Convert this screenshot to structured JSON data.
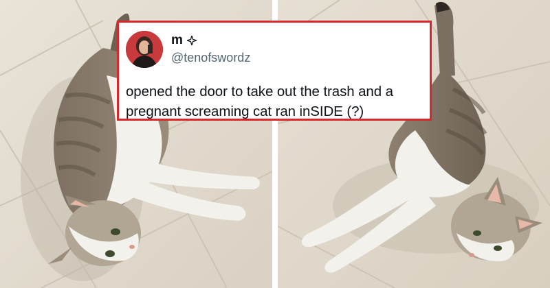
{
  "post": {
    "display_name": "m",
    "name_badge_icon": "sparkle-icon",
    "handle": "@tenofswordz",
    "text": "opened the door to take out the trash and a pregnant screaming cat ran inSIDE (?)",
    "frame_color": "#d9262b"
  },
  "photos": [
    {
      "subject": "cat-photo-left"
    },
    {
      "subject": "cat-photo-right"
    }
  ],
  "colors": {
    "floor": "#e3dccf",
    "grout": "#cfc6b6",
    "cat_white": "#f3f1ec",
    "cat_tabby": "#8a7d6d",
    "avatar_bg": "#c93a3d"
  }
}
